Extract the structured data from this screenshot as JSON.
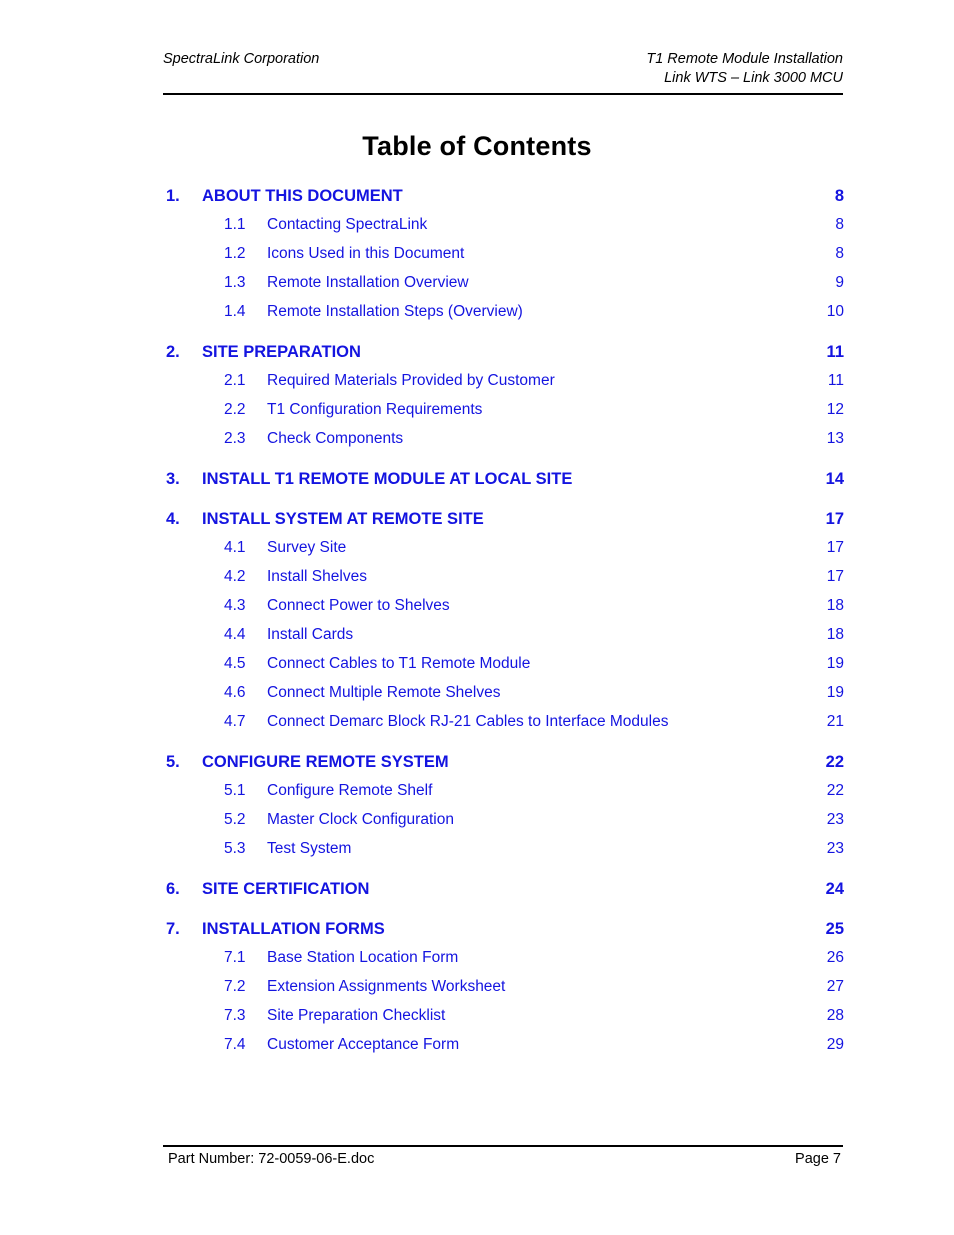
{
  "header": {
    "left": "SpectraLink Corporation",
    "right_line1": "T1 Remote Module Installation",
    "right_line2": "Link WTS – Link 3000 MCU"
  },
  "title": "Table of Contents",
  "toc": {
    "entries": [
      {
        "level": 1,
        "number": "1.",
        "label": "ABOUT THIS DOCUMENT",
        "page": "8"
      },
      {
        "level": 2,
        "number": "1.1",
        "label": "Contacting SpectraLink",
        "page": "8"
      },
      {
        "level": 2,
        "number": "1.2",
        "label": "Icons Used in this Document",
        "page": "8"
      },
      {
        "level": 2,
        "number": "1.3",
        "label": "Remote Installation Overview",
        "page": "9"
      },
      {
        "level": 2,
        "number": "1.4",
        "label": "Remote Installation Steps (Overview)",
        "page": "10"
      },
      {
        "level": 1,
        "number": "2.",
        "label": "SITE PREPARATION",
        "page": "11"
      },
      {
        "level": 2,
        "number": "2.1",
        "label": "Required Materials Provided by Customer",
        "page": "11"
      },
      {
        "level": 2,
        "number": "2.2",
        "label": "T1 Configuration Requirements",
        "page": "12"
      },
      {
        "level": 2,
        "number": "2.3",
        "label": "Check Components",
        "page": "13"
      },
      {
        "level": 1,
        "number": "3.",
        "label": "INSTALL T1 REMOTE MODULE AT LOCAL SITE",
        "page": "14"
      },
      {
        "level": 1,
        "number": "4.",
        "label": "INSTALL SYSTEM AT REMOTE SITE",
        "page": "17"
      },
      {
        "level": 2,
        "number": "4.1",
        "label": "Survey Site",
        "page": "17"
      },
      {
        "level": 2,
        "number": "4.2",
        "label": "Install Shelves",
        "page": "17"
      },
      {
        "level": 2,
        "number": "4.3",
        "label": "Connect Power to Shelves",
        "page": "18"
      },
      {
        "level": 2,
        "number": "4.4",
        "label": "Install Cards",
        "page": "18"
      },
      {
        "level": 2,
        "number": "4.5",
        "label": "Connect Cables to T1 Remote Module",
        "page": "19"
      },
      {
        "level": 2,
        "number": "4.6",
        "label": "Connect Multiple Remote Shelves",
        "page": "19"
      },
      {
        "level": 2,
        "number": "4.7",
        "label": "Connect Demarc Block RJ-21 Cables to Interface Modules",
        "page": "21"
      },
      {
        "level": 1,
        "number": "5.",
        "label": "CONFIGURE REMOTE SYSTEM",
        "page": "22"
      },
      {
        "level": 2,
        "number": "5.1",
        "label": "Configure Remote Shelf",
        "page": "22"
      },
      {
        "level": 2,
        "number": "5.2",
        "label": "Master Clock Configuration",
        "page": "23"
      },
      {
        "level": 2,
        "number": "5.3",
        "label": "Test System",
        "page": "23"
      },
      {
        "level": 1,
        "number": "6.",
        "label": "SITE CERTIFICATION",
        "page": "24"
      },
      {
        "level": 1,
        "number": "7.",
        "label": "INSTALLATION FORMS",
        "page": "25"
      },
      {
        "level": 2,
        "number": "7.1",
        "label": "Base Station Location Form",
        "page": "26"
      },
      {
        "level": 2,
        "number": "7.2",
        "label": "Extension Assignments Worksheet",
        "page": "27"
      },
      {
        "level": 2,
        "number": "7.3",
        "label": "Site Preparation Checklist",
        "page": "28"
      },
      {
        "level": 2,
        "number": "7.4",
        "label": "Customer Acceptance Form",
        "page": "29"
      }
    ]
  },
  "footer": {
    "part_number": "Part Number: 72-0059-06-E.doc",
    "page_label": "Page 7"
  },
  "colors": {
    "link_blue": "#1414e0",
    "text_black": "#000000",
    "background": "#ffffff"
  }
}
